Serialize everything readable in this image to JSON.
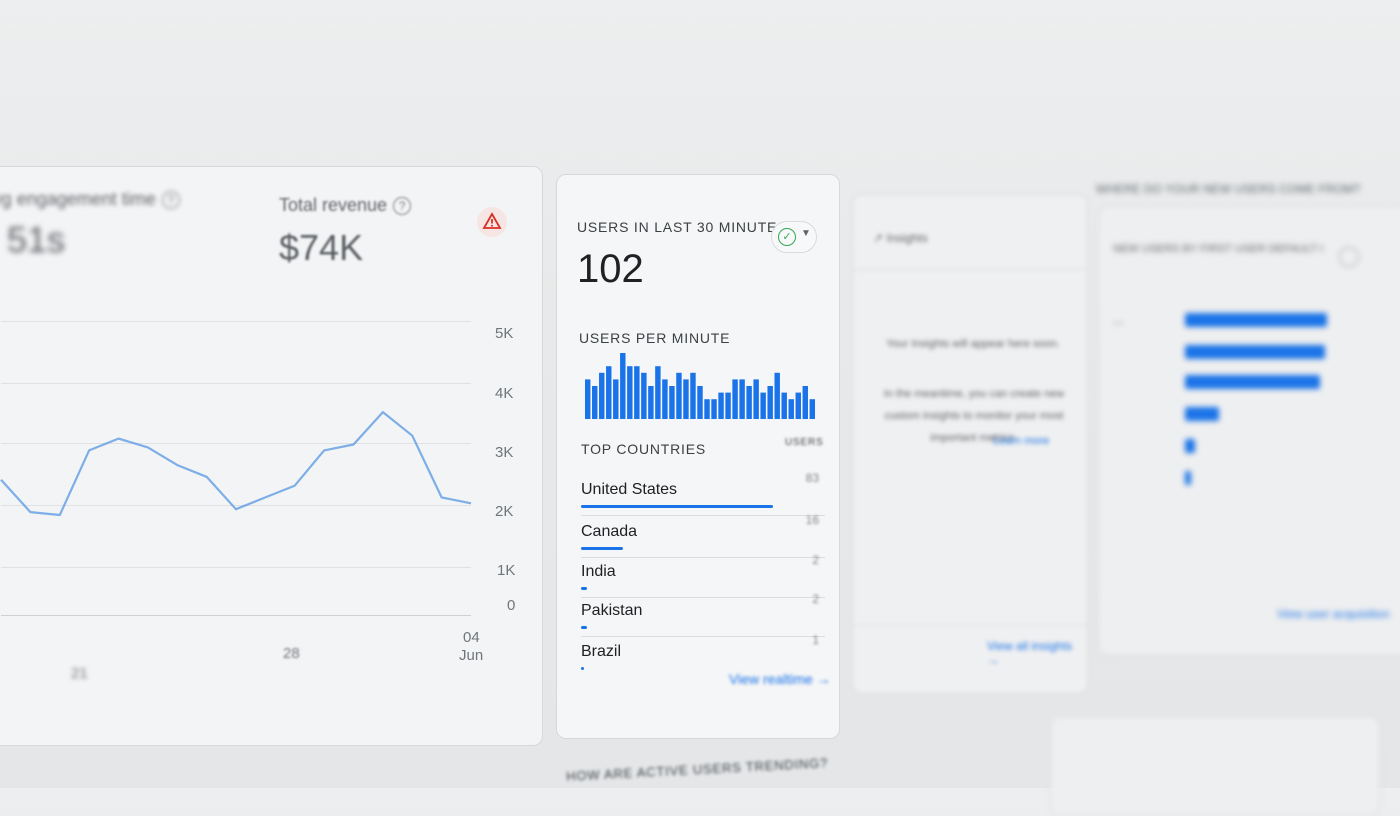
{
  "left_card": {
    "metric1": {
      "label": "Avg engagement time",
      "value": "51s"
    },
    "metric2": {
      "label": "Total revenue",
      "value": "$74K"
    },
    "y_ticks": [
      "5K",
      "4K",
      "3K",
      "2K",
      "1K",
      "0"
    ],
    "x_ticks": [
      "21",
      "28",
      "04",
      "Jun"
    ]
  },
  "realtime": {
    "title": "USERS IN LAST 30 MINUTES",
    "value": "102",
    "per_minute_title": "USERS PER MINUTE",
    "top_countries_title": "TOP COUNTRIES",
    "users_col": "USERS",
    "countries": [
      {
        "name": "United States",
        "value": "83",
        "share": 1.0
      },
      {
        "name": "Canada",
        "value": "16",
        "share": 0.22
      },
      {
        "name": "India",
        "value": "2",
        "share": 0.03
      },
      {
        "name": "Pakistan",
        "value": "2",
        "share": 0.03
      },
      {
        "name": "Brazil",
        "value": "1",
        "share": 0.015
      }
    ],
    "view_link": "View realtime",
    "per_minute": [
      6,
      5,
      7,
      8,
      6,
      10,
      8,
      8,
      7,
      5,
      8,
      6,
      5,
      7,
      6,
      7,
      5,
      3,
      3,
      4,
      4,
      6,
      6,
      5,
      6,
      4,
      5,
      7,
      4,
      3,
      4,
      5,
      3
    ]
  },
  "insights": {
    "title": "Insights",
    "text1": "Your Insights will appear here soon.",
    "text2": "In the meantime, you can create new custom insights to monitor your most important metrics.",
    "link1": "Learn more",
    "link2": "View all insights"
  },
  "right_card": {
    "title": "NEW USERS BY FIRST USER DEFAULT CHANNEL GROUP",
    "link": "View user acquisition"
  },
  "bottom": {
    "trend_title": "HOW ARE ACTIVE USERS TRENDING?",
    "right_title": "WHERE DO YOUR NEW USERS COME FROM?"
  },
  "chart_data": [
    {
      "type": "line",
      "title": "",
      "x_labels": [
        "21",
        "28",
        "04 Jun"
      ],
      "ylim": [
        0,
        5000
      ],
      "series": [
        {
          "values": [
            2300,
            1750,
            1700,
            2800,
            3000,
            2850,
            2550,
            2350,
            1800,
            2000,
            2200,
            2800,
            2900,
            3450,
            3050,
            2000,
            1900
          ]
        }
      ]
    },
    {
      "type": "bar",
      "title": "USERS PER MINUTE",
      "values": [
        6,
        5,
        7,
        8,
        6,
        10,
        8,
        8,
        7,
        5,
        8,
        6,
        5,
        7,
        6,
        7,
        5,
        3,
        3,
        4,
        4,
        6,
        6,
        5,
        6,
        4,
        5,
        7,
        4,
        3,
        4,
        5,
        3
      ]
    },
    {
      "type": "bar",
      "title": "TOP COUNTRIES",
      "categories": [
        "United States",
        "Canada",
        "India",
        "Pakistan",
        "Brazil"
      ],
      "values": [
        83,
        16,
        2,
        2,
        1
      ]
    }
  ]
}
